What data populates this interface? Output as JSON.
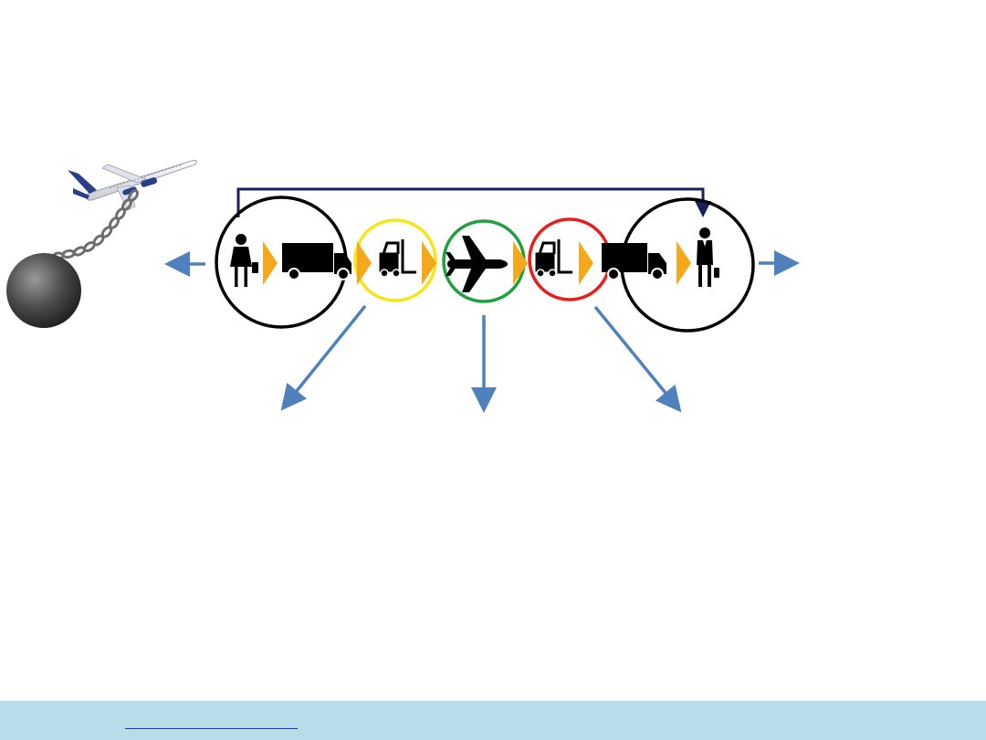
{
  "diagram": {
    "title": "",
    "circle_colors": {
      "shipper": "#000000",
      "origin_handling": "#f5e61a",
      "air_transport": "#20a040",
      "destination_handling": "#e61e1e",
      "consignee": "#000000"
    },
    "chevron_color": "#f5a81c",
    "arrow_color": "#4f81bd",
    "feedback_line_color": "#1a1f5e",
    "icons": [
      "plane-with-ball-and-chain-icon",
      "businesswoman-icon",
      "delivery-truck-icon",
      "forklift-icon",
      "airplane-icon",
      "businessman-icon"
    ]
  },
  "footer": {
    "background": "#b7dde8",
    "link_text": ""
  }
}
